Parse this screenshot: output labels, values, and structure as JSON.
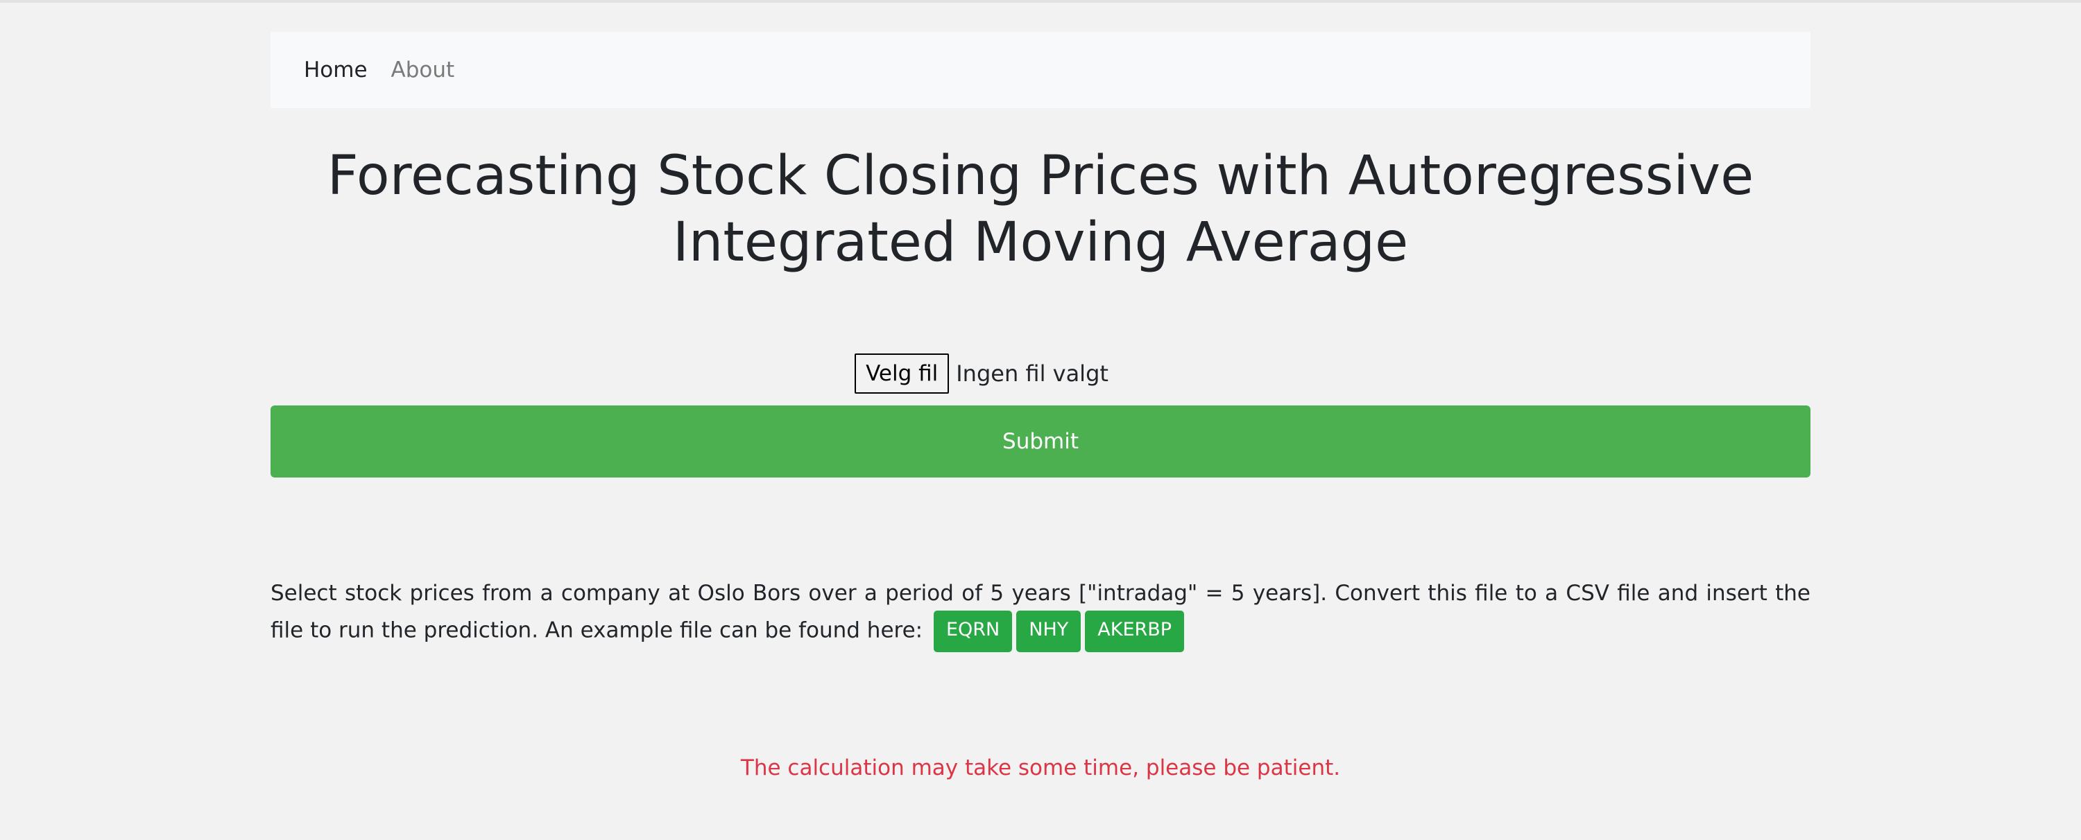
{
  "nav": {
    "home_label": "Home",
    "about_label": "About"
  },
  "page": {
    "title": "Forecasting Stock Closing Prices with Autoregressive Integrated Moving Average"
  },
  "upload": {
    "choose_file_label": "Velg fil",
    "no_file_label": "Ingen fil valgt",
    "submit_label": "Submit"
  },
  "description": {
    "text": "Select stock prices from a company at Oslo Bors over a period of 5 years [\"intradag\" = 5 years]. Convert this file to a CSV file and insert the file to run the prediction. An example file can be found here:",
    "example_files": [
      "EQRN",
      "NHY",
      "AKERBP"
    ]
  },
  "notice": {
    "text": "The calculation may take some time, please be patient."
  },
  "colors": {
    "submit": "#4caf50",
    "example_button": "#28a745",
    "notice": "#dc3545",
    "navbar": "#f8f9fa",
    "background": "#f2f2f2"
  }
}
